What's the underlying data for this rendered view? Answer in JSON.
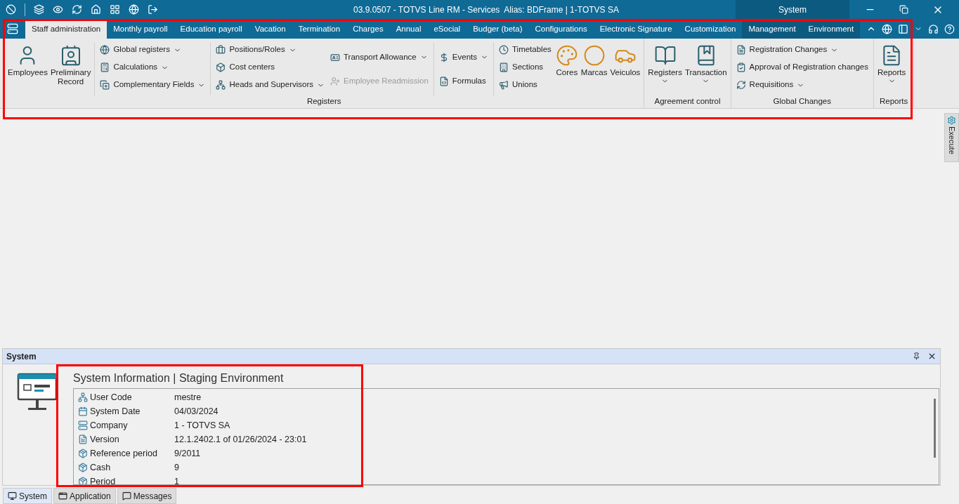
{
  "title_bar": {
    "title": "03.9.0507 - TOTVS Line RM - Services  Alias: BDFrame | 1-TOTVS SA",
    "context": "System"
  },
  "ribbon_tabs": [
    {
      "label": "Staff administration",
      "selected": true,
      "kind": "standard"
    },
    {
      "label": "Monthly payroll",
      "selected": false,
      "kind": "standard"
    },
    {
      "label": "Education payroll",
      "selected": false,
      "kind": "standard"
    },
    {
      "label": "Vacation",
      "selected": false,
      "kind": "standard"
    },
    {
      "label": "Termination",
      "selected": false,
      "kind": "standard"
    },
    {
      "label": "Charges",
      "selected": false,
      "kind": "standard"
    },
    {
      "label": "Annual",
      "selected": false,
      "kind": "standard"
    },
    {
      "label": "eSocial",
      "selected": false,
      "kind": "standard"
    },
    {
      "label": "Budger (beta)",
      "selected": false,
      "kind": "standard"
    },
    {
      "label": "Configurations",
      "selected": false,
      "kind": "standard"
    },
    {
      "label": "Electronic Signature",
      "selected": false,
      "kind": "standard"
    },
    {
      "label": "Customization",
      "selected": false,
      "kind": "standard"
    },
    {
      "label": "Management",
      "selected": false,
      "kind": "contextual"
    },
    {
      "label": "Environment",
      "selected": false,
      "kind": "contextual"
    }
  ],
  "ribbon_groups": [
    {
      "label": "Registers",
      "columns": [
        {
          "separated": false,
          "items": [
            {
              "kind": "large",
              "label": "Employees",
              "dropdown": false
            }
          ]
        },
        {
          "separated": false,
          "items": [
            {
              "kind": "large",
              "label": "Preliminary\nRecord",
              "dropdown": false
            }
          ]
        },
        {
          "separated": true,
          "items": [
            {
              "kind": "small",
              "label": "Global registers",
              "dropdown": true,
              "disabled": false
            },
            {
              "kind": "small",
              "label": "Calculations",
              "dropdown": true,
              "disabled": false
            },
            {
              "kind": "small",
              "label": "Complementary Fields",
              "dropdown": true,
              "disabled": false
            }
          ]
        },
        {
          "separated": true,
          "items": [
            {
              "kind": "small",
              "label": "Positions/Roles",
              "dropdown": true,
              "disabled": false
            },
            {
              "kind": "small",
              "label": "Cost centers",
              "dropdown": false,
              "disabled": false
            },
            {
              "kind": "small",
              "label": "Heads and Supervisors",
              "dropdown": true,
              "disabled": false
            }
          ]
        },
        {
          "separated": false,
          "items": [
            {
              "kind": "small",
              "label": "Transport Allowance",
              "dropdown": true,
              "disabled": false
            },
            {
              "kind": "small",
              "label": "Employee Readmission",
              "dropdown": false,
              "disabled": true
            }
          ]
        },
        {
          "separated": true,
          "items": [
            {
              "kind": "small",
              "label": "Events",
              "dropdown": true,
              "disabled": false
            },
            {
              "kind": "small",
              "label": "Formulas",
              "dropdown": false,
              "disabled": false
            }
          ]
        },
        {
          "separated": true,
          "items": [
            {
              "kind": "small",
              "label": "Timetables",
              "dropdown": false,
              "disabled": false
            },
            {
              "kind": "small",
              "label": "Sections",
              "dropdown": false,
              "disabled": false
            },
            {
              "kind": "small",
              "label": "Unions",
              "dropdown": false,
              "disabled": false
            }
          ]
        },
        {
          "separated": false,
          "items": [
            {
              "kind": "large",
              "label": "Cores",
              "dropdown": false
            }
          ]
        },
        {
          "separated": false,
          "items": [
            {
              "kind": "large",
              "label": "Marcas",
              "dropdown": false
            }
          ]
        },
        {
          "separated": false,
          "items": [
            {
              "kind": "large",
              "label": "Veiculos",
              "dropdown": false
            }
          ]
        }
      ]
    },
    {
      "label": "Agreement control",
      "columns": [
        {
          "separated": false,
          "items": [
            {
              "kind": "large",
              "label": "Registers",
              "dropdown": true
            }
          ]
        },
        {
          "separated": false,
          "items": [
            {
              "kind": "large",
              "label": "Transaction",
              "dropdown": true
            }
          ]
        }
      ]
    },
    {
      "label": "Global Changes",
      "columns": [
        {
          "separated": false,
          "items": [
            {
              "kind": "small",
              "label": "Registration Changes",
              "dropdown": true,
              "disabled": false
            },
            {
              "kind": "small",
              "label": "Approval of Registration changes",
              "dropdown": false,
              "disabled": false
            },
            {
              "kind": "small",
              "label": "Requisitions",
              "dropdown": true,
              "disabled": false
            }
          ]
        }
      ]
    },
    {
      "label": "Reports",
      "columns": [
        {
          "separated": false,
          "items": [
            {
              "kind": "large",
              "label": "Reports",
              "dropdown": true
            }
          ]
        }
      ]
    }
  ],
  "side_panel": {
    "label": "Execute"
  },
  "system_panel": {
    "title": "System",
    "heading": "System Information | Staging Environment",
    "rows": [
      {
        "label": "User Code",
        "value": "mestre"
      },
      {
        "label": "System Date",
        "value": "04/03/2024"
      },
      {
        "label": "Company",
        "value": "1 - TOTVS SA"
      },
      {
        "label": "Version",
        "value": "12.1.2402.1 of 01/26/2024 - 23:01"
      },
      {
        "label": "Reference period",
        "value": "9/2011"
      },
      {
        "label": "Cash",
        "value": "9"
      },
      {
        "label": "Period",
        "value": "1"
      }
    ]
  },
  "bottom_tabs": [
    {
      "label": "System",
      "selected": true
    },
    {
      "label": "Application",
      "selected": false
    },
    {
      "label": "Messages",
      "selected": false
    }
  ]
}
